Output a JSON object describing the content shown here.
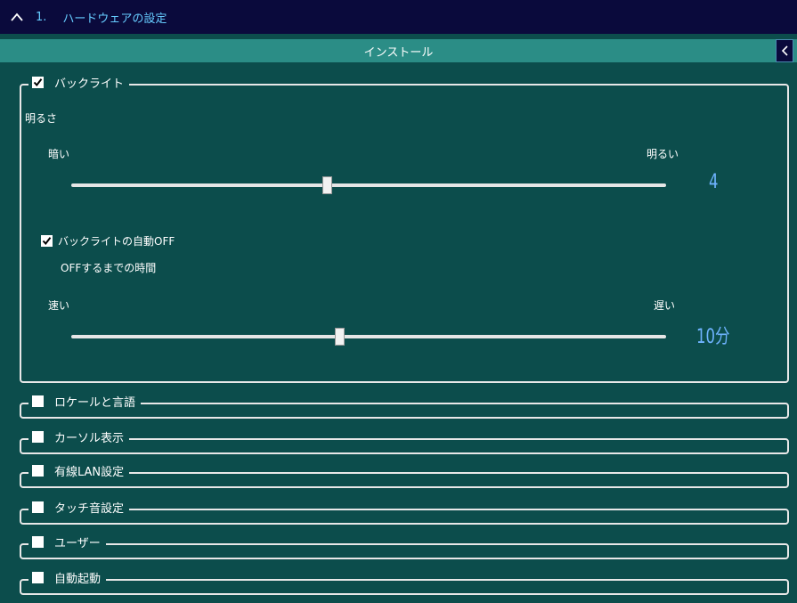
{
  "header": {
    "section_number": "1.",
    "section_title": "ハードウェアの設定"
  },
  "install_bar": {
    "label": "インストール"
  },
  "backlight": {
    "checked": true,
    "title": "バックライト",
    "brightness_label": "明るさ",
    "min_label": "暗い",
    "max_label": "明るい",
    "brightness_level": 0.43,
    "brightness_value": "4",
    "auto_off": {
      "checked": true,
      "label": "バックライトの自動OFF",
      "time_label": "OFFするまでの時間",
      "min_label": "速い",
      "max_label": "遅い",
      "level": 0.45,
      "value": "10分"
    }
  },
  "groups": [
    {
      "title": "ロケールと言語",
      "checked": false
    },
    {
      "title": "カーソル表示",
      "checked": false
    },
    {
      "title": "有線LAN設定",
      "checked": false
    },
    {
      "title": "タッチ音設定",
      "checked": false
    },
    {
      "title": "ユーザー",
      "checked": false
    },
    {
      "title": "自動起動",
      "checked": false
    }
  ],
  "colors": {
    "background": "#0c4d4c",
    "install_bar": "#2b8d86",
    "top_bar": "#0a0a3c",
    "value_text": "#6fb3ff",
    "header_text": "#66ccff"
  }
}
